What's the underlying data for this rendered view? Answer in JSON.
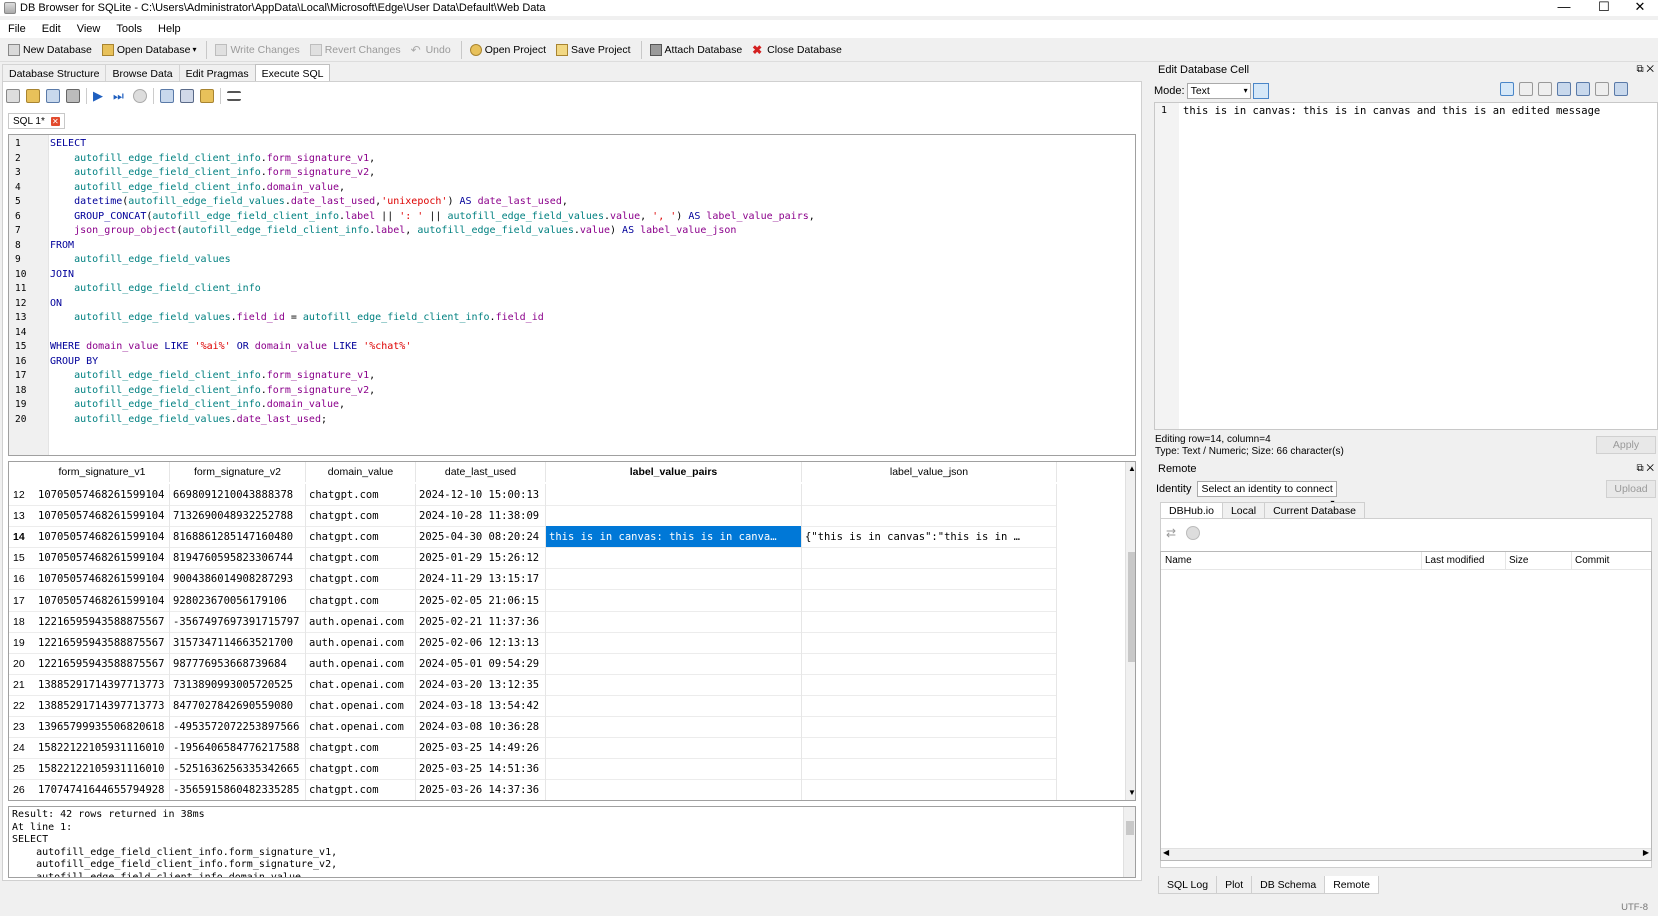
{
  "window": {
    "title": "DB Browser for SQLite - C:\\Users\\Administrator\\AppData\\Local\\Microsoft\\Edge\\User Data\\Default\\Web Data",
    "minimize": "—",
    "maximize": "☐",
    "close": "✕"
  },
  "menu": [
    "File",
    "Edit",
    "View",
    "Tools",
    "Help"
  ],
  "toolbar": {
    "new_db": "New Database",
    "open_db": "Open Database",
    "write": "Write Changes",
    "revert": "Revert Changes",
    "undo": "Undo",
    "open_project": "Open Project",
    "save_project": "Save Project",
    "attach": "Attach Database",
    "close_db": "Close Database"
  },
  "tabs": [
    "Database Structure",
    "Browse Data",
    "Edit Pragmas",
    "Execute SQL"
  ],
  "sql_tab": {
    "label": "SQL 1*",
    "close": "✕"
  },
  "sql_lines": [
    {
      "n": "1",
      "html": "<span class='kw'>SELECT</span>"
    },
    {
      "n": "2",
      "html": "    <span class='id'>autofill_edge_field_client_info</span>.<span class='fn'>form_signature_v1</span>,"
    },
    {
      "n": "3",
      "html": "    <span class='id'>autofill_edge_field_client_info</span>.<span class='fn'>form_signature_v2</span>,"
    },
    {
      "n": "4",
      "html": "    <span class='id'>autofill_edge_field_client_info</span>.<span class='fn'>domain_value</span>,"
    },
    {
      "n": "5",
      "html": "    <span class='kw'>datetime</span>(<span class='id'>autofill_edge_field_values</span>.<span class='fn'>date_last_used</span>,<span class='str'>'unixepoch'</span>) <span class='kw'>AS</span> <span class='fn'>date_last_used</span>,"
    },
    {
      "n": "6",
      "html": "    <span class='kw'>GROUP_CONCAT</span>(<span class='id'>autofill_edge_field_client_info</span>.<span class='fn'>label</span> || <span class='str'>': '</span> || <span class='id'>autofill_edge_field_values</span>.<span class='fn'>value</span>, <span class='str'>', '</span>) <span class='kw'>AS</span> <span class='fn'>label_value_pairs</span>,"
    },
    {
      "n": "7",
      "html": "    <span class='fn'>json_group_object</span>(<span class='id'>autofill_edge_field_client_info</span>.<span class='fn'>label</span>, <span class='id'>autofill_edge_field_values</span>.<span class='fn'>value</span>) <span class='kw'>AS</span> <span class='fn'>label_value_json</span>"
    },
    {
      "n": "8",
      "html": "<span class='kw'>FROM</span>"
    },
    {
      "n": "9",
      "html": "    <span class='id'>autofill_edge_field_values</span>"
    },
    {
      "n": "10",
      "html": "<span class='kw'>JOIN</span>"
    },
    {
      "n": "11",
      "html": "    <span class='id'>autofill_edge_field_client_info</span>"
    },
    {
      "n": "12",
      "html": "<span class='kw'>ON</span>"
    },
    {
      "n": "13",
      "html": "    <span class='id'>autofill_edge_field_values</span>.<span class='fn'>field_id</span> = <span class='id'>autofill_edge_field_client_info</span>.<span class='fn'>field_id</span>"
    },
    {
      "n": "14",
      "html": ""
    },
    {
      "n": "15",
      "html": "<span class='kw'>WHERE</span> <span class='fn'>domain_value</span> <span class='kw'>LIKE</span> <span class='str'>'%ai%'</span> <span class='kw'>OR</span> <span class='fn'>domain_value</span> <span class='kw'>LIKE</span> <span class='str'>'%chat%'</span>"
    },
    {
      "n": "16",
      "html": "<span class='kw'>GROUP BY</span>"
    },
    {
      "n": "17",
      "html": "    <span class='id'>autofill_edge_field_client_info</span>.<span class='fn'>form_signature_v1</span>,"
    },
    {
      "n": "18",
      "html": "    <span class='id'>autofill_edge_field_client_info</span>.<span class='fn'>form_signature_v2</span>,"
    },
    {
      "n": "19",
      "html": "    <span class='id'>autofill_edge_field_client_info</span>.<span class='fn'>domain_value</span>,"
    },
    {
      "n": "20",
      "html": "    <span class='id'>autofill_edge_field_values</span>.<span class='fn'>date_last_used</span>;"
    }
  ],
  "grid": {
    "columns": [
      "form_signature_v1",
      "form_signature_v2",
      "domain_value",
      "date_last_used",
      "label_value_pairs",
      "label_value_json"
    ],
    "rows": [
      {
        "n": "12",
        "c": [
          "10705057468261599104",
          "6698091210043888378",
          "chatgpt.com",
          "2024-12-10 15:00:13",
          "",
          ""
        ]
      },
      {
        "n": "13",
        "c": [
          "10705057468261599104",
          "7132690048932252788",
          "chatgpt.com",
          "2024-10-28 11:38:09",
          "",
          ""
        ]
      },
      {
        "n": "14",
        "c": [
          "10705057468261599104",
          "8168861285147160480",
          "chatgpt.com",
          "2025-04-30 08:20:24",
          "this is in canvas: this is in canva…",
          "{\"this is in canvas\":\"this is in …"
        ],
        "selected": true
      },
      {
        "n": "15",
        "c": [
          "10705057468261599104",
          "8194760595823306744",
          "chatgpt.com",
          "2025-01-29 15:26:12",
          "",
          ""
        ]
      },
      {
        "n": "16",
        "c": [
          "10705057468261599104",
          "9004386014908287293",
          "chatgpt.com",
          "2024-11-29 13:15:17",
          "",
          ""
        ]
      },
      {
        "n": "17",
        "c": [
          "10705057468261599104",
          "928023670056179106",
          "chatgpt.com",
          "2025-02-05 21:06:15",
          "",
          ""
        ]
      },
      {
        "n": "18",
        "c": [
          "12216595943588875567",
          "-3567497697391715797",
          "auth.openai.com",
          "2025-02-21 11:37:36",
          "",
          ""
        ]
      },
      {
        "n": "19",
        "c": [
          "12216595943588875567",
          "3157347114663521700",
          "auth.openai.com",
          "2025-02-06 12:13:13",
          "",
          ""
        ]
      },
      {
        "n": "20",
        "c": [
          "12216595943588875567",
          "987776953668739684",
          "auth.openai.com",
          "2024-05-01 09:54:29",
          "",
          ""
        ]
      },
      {
        "n": "21",
        "c": [
          "13885291714397713773",
          "7313890993005720525",
          "chat.openai.com",
          "2024-03-20 13:12:35",
          "",
          ""
        ]
      },
      {
        "n": "22",
        "c": [
          "13885291714397713773",
          "8477027842690559080",
          "chat.openai.com",
          "2024-03-18 13:54:42",
          "",
          ""
        ]
      },
      {
        "n": "23",
        "c": [
          "13965799935506820618",
          "-4953572072253897566",
          "chat.openai.com",
          "2024-03-08 10:36:28",
          "",
          ""
        ]
      },
      {
        "n": "24",
        "c": [
          "15822122105931116010",
          "-1956406584776217588",
          "chatgpt.com",
          "2025-03-25 14:49:26",
          "",
          ""
        ]
      },
      {
        "n": "25",
        "c": [
          "15822122105931116010",
          "-5251636256335342665",
          "chatgpt.com",
          "2025-03-25 14:51:36",
          "",
          ""
        ]
      },
      {
        "n": "26",
        "c": [
          "17074741644655794928",
          "-3565915860482335285",
          "chatgpt.com",
          "2025-03-26 14:37:36",
          "",
          ""
        ]
      }
    ]
  },
  "messages": [
    "Result: 42 rows returned in 38ms",
    "At line 1:",
    "SELECT",
    "    autofill_edge_field_client_info.form_signature_v1,",
    "    autofill_edge_field_client_info.form_signature_v2,",
    "    autofill_edge_field_client_info.domain_value,"
  ],
  "edit_cell": {
    "title": "Edit Database Cell",
    "mode_label": "Mode:",
    "mode_value": "Text",
    "line_no": "1",
    "content": "this is in canvas: this is in canvas and this is an edited message",
    "status1": "Editing row=14, column=4",
    "status2": "Type: Text / Numeric; Size: 66 character(s)",
    "apply": "Apply"
  },
  "remote": {
    "title": "Remote",
    "identity_label": "Identity",
    "identity_value": "Select an identity to connect",
    "upload": "Upload",
    "tabs": [
      "DBHub.io",
      "Local",
      "Current Database"
    ],
    "columns": [
      "Name",
      "Last modified",
      "Size",
      "Commit"
    ]
  },
  "bottom_tabs": [
    "SQL Log",
    "Plot",
    "DB Schema",
    "Remote"
  ],
  "status": {
    "encoding": "UTF-8"
  }
}
